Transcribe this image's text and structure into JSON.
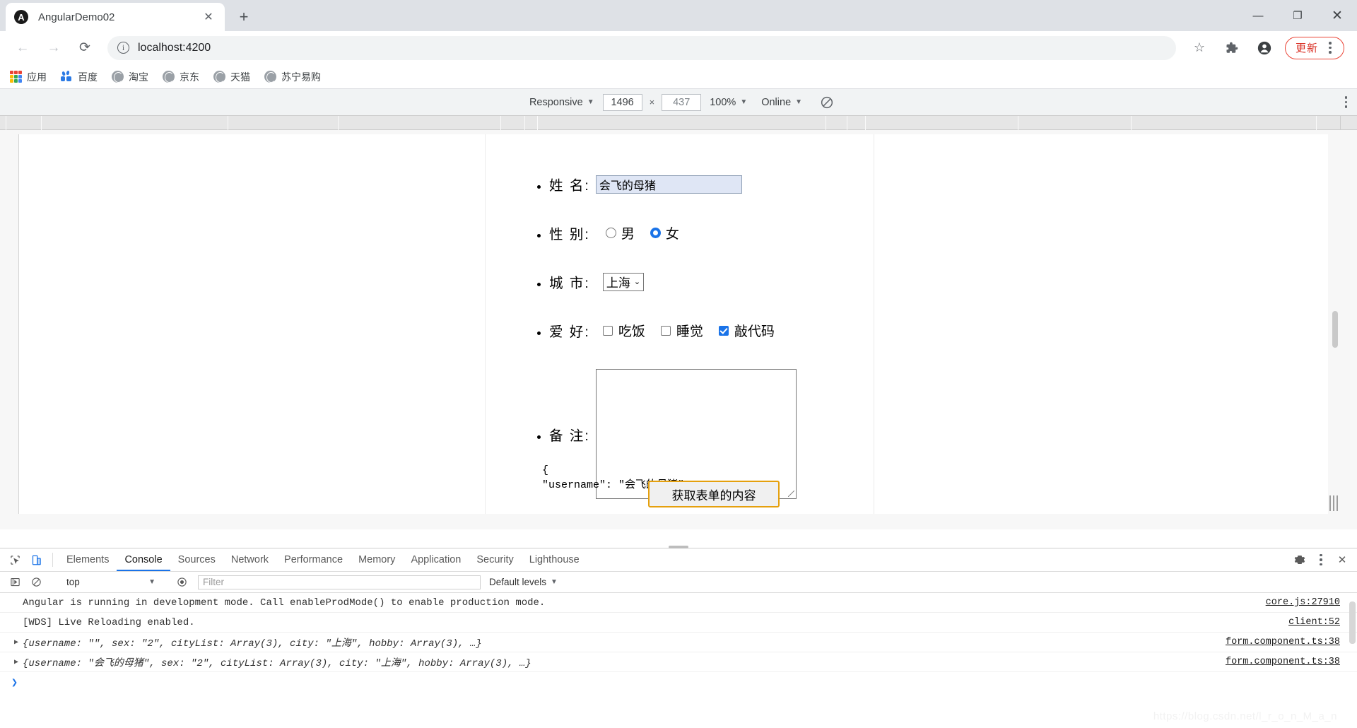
{
  "browser": {
    "tab": {
      "title": "AngularDemo02",
      "favicon": "angular-icon",
      "close": "✕"
    },
    "new_tab": "+",
    "window_controls": {
      "minimize": "—",
      "maximize": "❐",
      "close": "✕"
    },
    "nav": {
      "back": "←",
      "forward": "→",
      "reload": "⟳"
    },
    "omnibox": {
      "info_icon": "ⓘ",
      "url": "localhost:4200"
    },
    "actions": {
      "bookmark": "☆",
      "extensions": "puzzle-icon",
      "profile": "account-icon",
      "update_label": "更新"
    },
    "bookmarks": [
      {
        "label": "应用",
        "icon": "apps-grid-icon"
      },
      {
        "label": "百度",
        "icon": "baidu-icon"
      },
      {
        "label": "淘宝",
        "icon": "globe-icon"
      },
      {
        "label": "京东",
        "icon": "globe-icon"
      },
      {
        "label": "天猫",
        "icon": "globe-icon"
      },
      {
        "label": "苏宁易购",
        "icon": "globe-icon"
      }
    ]
  },
  "device_toolbar": {
    "device": "Responsive",
    "width": "1496",
    "height": "437",
    "separator": "×",
    "zoom": "100%",
    "network": "Online",
    "rotate_icon": "rotate-icon"
  },
  "page": {
    "form": {
      "fields": [
        {
          "label": "姓 名:",
          "type": "text",
          "value": "会飞的母猪"
        },
        {
          "label": "性 别:",
          "type": "radio",
          "options": [
            {
              "label": "男",
              "value": "1",
              "checked": false
            },
            {
              "label": "女",
              "value": "2",
              "checked": true
            }
          ]
        },
        {
          "label": "城 市:",
          "type": "select",
          "value": "上海"
        },
        {
          "label": "爱 好:",
          "type": "checkbox",
          "options": [
            {
              "label": "吃饭",
              "checked": false
            },
            {
              "label": "睡觉",
              "checked": false
            },
            {
              "label": "敲代码",
              "checked": true
            }
          ]
        },
        {
          "label": "备 注:",
          "type": "textarea",
          "value": ""
        }
      ],
      "submit_label": "获取表单的内容",
      "json_output": "{\n\"username\": \"会飞的母猪\","
    }
  },
  "devtools": {
    "tabs": [
      "Elements",
      "Console",
      "Sources",
      "Network",
      "Performance",
      "Memory",
      "Application",
      "Security",
      "Lighthouse"
    ],
    "active_tab": "Console",
    "tools": {
      "inspect": "inspect-icon",
      "device": "device-toggle-icon",
      "settings": "gear-icon",
      "more": "kebab-icon",
      "close": "close-icon"
    },
    "filterbar": {
      "execute": "execute-icon",
      "clear": "clear-icon",
      "context": "top",
      "eye": "eye-icon",
      "filter_placeholder": "Filter",
      "levels": "Default levels"
    },
    "messages": [
      {
        "expandable": false,
        "text": "Angular is running in development mode. Call enableProdMode() to enable production mode.",
        "source": "core.js:27910"
      },
      {
        "expandable": false,
        "text": "[WDS] Live Reloading enabled.",
        "source": "client:52"
      },
      {
        "expandable": true,
        "text": "{username: \"\", sex: \"2\", cityList: Array(3), city: \"上海\", hobby: Array(3), …}",
        "source": "form.component.ts:38"
      },
      {
        "expandable": true,
        "text": "{username: \"会飞的母猪\", sex: \"2\", cityList: Array(3), city: \"上海\", hobby: Array(3), …}",
        "source": "form.component.ts:38"
      }
    ],
    "prompt": "❯"
  },
  "watermark": "https://blog.csdn.net/l_r_o_n_M_a_n"
}
